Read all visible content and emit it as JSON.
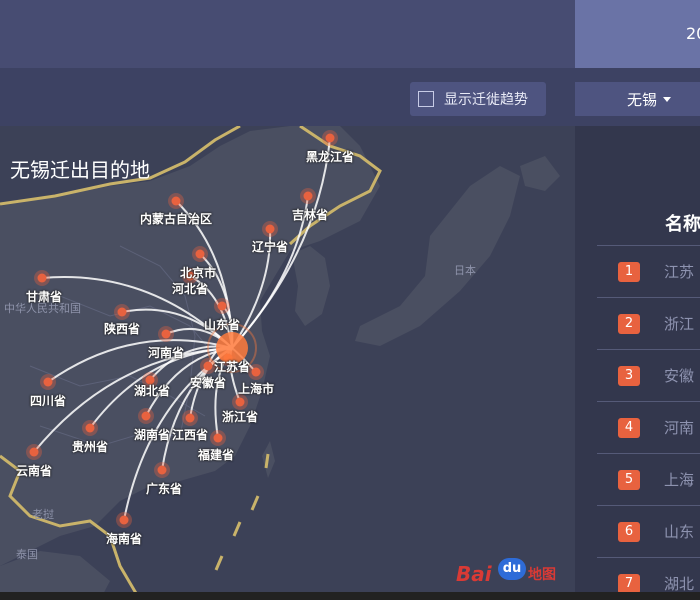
{
  "header": {
    "year_label": "20"
  },
  "toolbar": {
    "trend_label": "显示迁徙趋势",
    "city_label": "无锡"
  },
  "map": {
    "title": "无锡迁出目的地",
    "country_label": "中华人民共和国",
    "origin": "江苏省",
    "watermark": {
      "brand": "Bai",
      "du": "du",
      "product": "地图"
    },
    "neighbor_labels": [
      "日本",
      "老挝",
      "泰国"
    ],
    "destinations": [
      {
        "name": "黑龙江省"
      },
      {
        "name": "吉林省"
      },
      {
        "name": "辽宁省"
      },
      {
        "name": "内蒙古自治区"
      },
      {
        "name": "北京市"
      },
      {
        "name": "河北省"
      },
      {
        "name": "甘肃省"
      },
      {
        "name": "陕西省"
      },
      {
        "name": "山东省"
      },
      {
        "name": "河南省"
      },
      {
        "name": "江苏省"
      },
      {
        "name": "安徽省"
      },
      {
        "name": "上海市"
      },
      {
        "name": "湖北省"
      },
      {
        "name": "四川省"
      },
      {
        "name": "浙江省"
      },
      {
        "name": "贵州省"
      },
      {
        "name": "湖南省"
      },
      {
        "name": "江西省"
      },
      {
        "name": "福建省"
      },
      {
        "name": "云南省"
      },
      {
        "name": "广东省"
      },
      {
        "name": "海南省"
      }
    ]
  },
  "ranking": {
    "header": "名称",
    "items": [
      {
        "rank": "1",
        "name": "江苏"
      },
      {
        "rank": "2",
        "name": "浙江"
      },
      {
        "rank": "3",
        "name": "安徽"
      },
      {
        "rank": "4",
        "name": "河南"
      },
      {
        "rank": "5",
        "name": "上海"
      },
      {
        "rank": "6",
        "name": "山东"
      },
      {
        "rank": "7",
        "name": "湖北"
      }
    ]
  },
  "colors": {
    "accent": "#e8623f",
    "flow_line": "#ffffff",
    "border": "#c9b36a",
    "land": "#4a4f61",
    "sea": "#3c4157"
  }
}
